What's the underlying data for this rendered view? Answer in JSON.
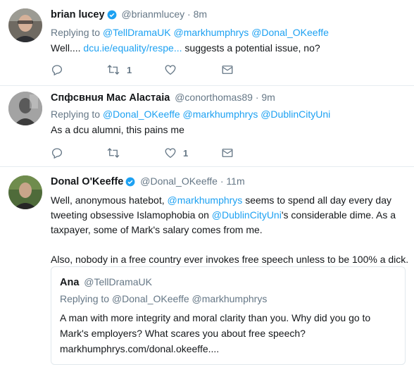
{
  "tweets": [
    {
      "name": "brian lucey",
      "handle": "@brianmlucey",
      "dot": "·",
      "time": "8m",
      "replying_label": "Replying to",
      "replying": [
        "@TellDramaUK",
        "@markhumphrys",
        "@Donal_OKeeffe"
      ],
      "text_before": "Well.... ",
      "text_link": "dcu.ie/equality/respe...",
      "text_after": " suggests a potential issue, no?",
      "retweet_count": "1",
      "like_count": ""
    },
    {
      "name": "Спфсвнuя Мас Аlастаiа",
      "handle": "@conorthomas89",
      "dot": "·",
      "time": "9m",
      "replying_label": "Replying to",
      "replying": [
        "@Donal_OKeeffe",
        "@markhumphrys",
        "@DublinCityUni"
      ],
      "text": "As a dcu alumni, this pains me",
      "retweet_count": "",
      "like_count": "1"
    },
    {
      "name": "Donal O'Keeffe",
      "handle": "@Donal_OKeeffe",
      "dot": "·",
      "time": "11m",
      "line1_a": "Well, anonymous hatebot, ",
      "line1_link": "@markhumphrys",
      "line1_b": " seems to spend all day every day",
      "line2_a": "tweeting obsessive Islamophobia on ",
      "line2_link": "@DublinCityUni",
      "line2_b": "'s considerable dime. As a",
      "line3": "taxpayer, some of Mark's salary comes from me.",
      "para2": "Also, nobody in a free country ever invokes free speech unless to be 100% a dick."
    }
  ],
  "quote": {
    "name": "Ana",
    "handle": "@TellDramaUK",
    "replying_label": "Replying to",
    "replying": [
      "@Donal_OKeeffe",
      "@markhumphrys"
    ],
    "line1": "A man with more integrity and moral clarity than you. Why did you go to",
    "line2": "Mark's employers? What scares you about free speech?",
    "line3": "markhumphrys.com/donal.okeeffe...."
  },
  "colors": {
    "link": "#1da1f2",
    "muted": "#657786",
    "verified": "#1da1f2"
  },
  "icons": [
    "reply-icon",
    "retweet-icon",
    "like-icon",
    "dm-icon",
    "verified-icon"
  ]
}
